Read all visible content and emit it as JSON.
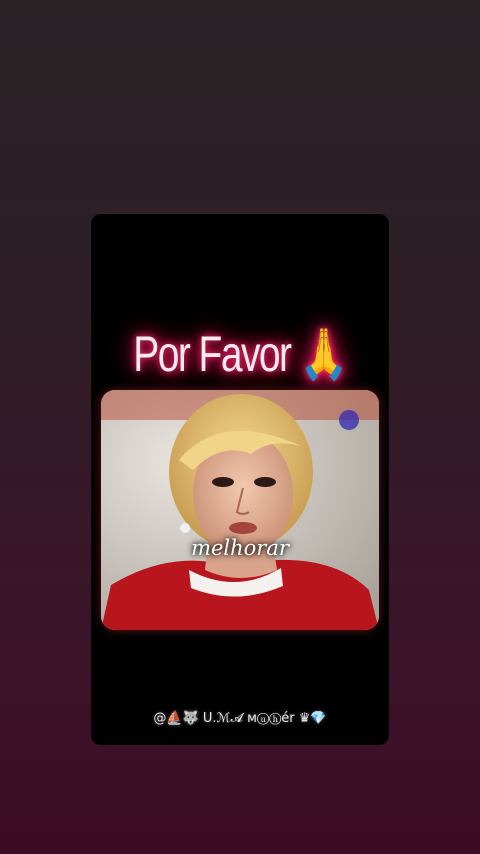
{
  "story": {
    "title": "Por Favor 🙏",
    "caption": "melhorar",
    "signature": "@⛵🐺 U.ℳ𝓐 ᴍⓤⓗér ♛💎"
  },
  "colors": {
    "title_glow": "#ff1a5c",
    "background_top": "#2a2326",
    "background_bottom": "#3d0c24"
  }
}
